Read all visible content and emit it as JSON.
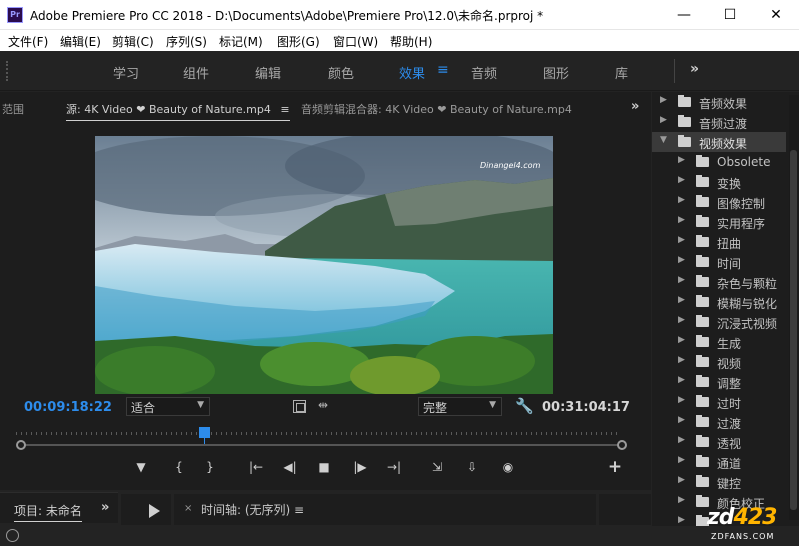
{
  "window": {
    "title": "Adobe Premiere Pro CC 2018 - D:\\Documents\\Adobe\\Premiere Pro\\12.0\\未命名.prproj *",
    "app_icon_text": "Pr",
    "controls": {
      "minimize": "—",
      "maximize": "☐",
      "close": "✕"
    }
  },
  "menu": [
    "文件(F)",
    "编辑(E)",
    "剪辑(C)",
    "序列(S)",
    "标记(M)",
    "图形(G)",
    "窗口(W)",
    "帮助(H)"
  ],
  "workspaces": {
    "tabs": [
      "学习",
      "组件",
      "编辑",
      "颜色",
      "效果",
      "音频",
      "图形",
      "库"
    ],
    "active": "效果",
    "menu_glyph": "≡",
    "more_glyph": "»"
  },
  "source_panel": {
    "tab_range": "范围",
    "tab_source": "源: 4K Video ❤ Beauty of Nature.mp4",
    "tab_source_menu": "≡",
    "tab_mixer": "音频剪辑混合器: 4K Video ❤ Beauty of Nature.mp4",
    "more_glyph": "»",
    "video_watermark": "Dinangel4.com",
    "timecode_current": "00:09:18:22",
    "timecode_duration": "00:31:04:17",
    "zoom": "适合",
    "quality": "完整",
    "playhead_fraction": 0.31
  },
  "transport": {
    "add_marker": "▼",
    "mark_in": "{",
    "mark_out": "}",
    "go_to_in": "|←",
    "step_back": "◀|",
    "stop": "■",
    "step_forward": "|▶",
    "go_to_out": "→|",
    "insert": "⇲",
    "overwrite": "⇩",
    "export_frame": "◉",
    "add": "+"
  },
  "effects": {
    "items": [
      {
        "label": "音频效果",
        "level": 0,
        "expanded": false
      },
      {
        "label": "音频过渡",
        "level": 0,
        "expanded": false
      },
      {
        "label": "视频效果",
        "level": 0,
        "expanded": true,
        "selected": true
      },
      {
        "label": "Obsolete",
        "level": 1
      },
      {
        "label": "变换",
        "level": 1
      },
      {
        "label": "图像控制",
        "level": 1
      },
      {
        "label": "实用程序",
        "level": 1
      },
      {
        "label": "扭曲",
        "level": 1
      },
      {
        "label": "时间",
        "level": 1
      },
      {
        "label": "杂色与颗粒",
        "level": 1
      },
      {
        "label": "模糊与锐化",
        "level": 1
      },
      {
        "label": "沉浸式视频",
        "level": 1
      },
      {
        "label": "生成",
        "level": 1
      },
      {
        "label": "视频",
        "level": 1
      },
      {
        "label": "调整",
        "level": 1
      },
      {
        "label": "过时",
        "level": 1
      },
      {
        "label": "过渡",
        "level": 1
      },
      {
        "label": "透视",
        "level": 1
      },
      {
        "label": "通道",
        "level": 1
      },
      {
        "label": "键控",
        "level": 1
      },
      {
        "label": "颜色校正",
        "level": 1
      },
      {
        "label": "",
        "level": 1
      }
    ]
  },
  "bottom": {
    "project_tab": "项目: 未命名",
    "project_more": "»",
    "timeline_close": "×",
    "timeline_tab": "时间轴: (无序列) ≡"
  },
  "site_watermark": {
    "logo_main": "zd",
    "logo_accent": "423",
    "domain": "ZDFANS.COM"
  }
}
